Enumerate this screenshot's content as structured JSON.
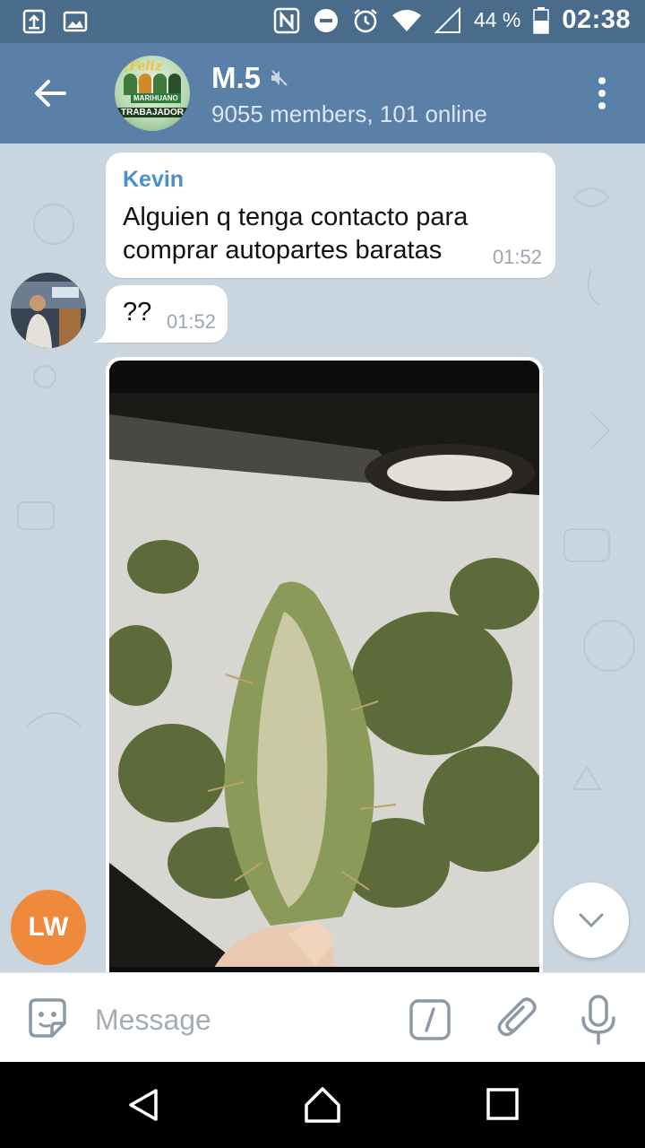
{
  "status_bar": {
    "icons": [
      "upload-icon",
      "image-icon",
      "nfc-icon",
      "do-not-disturb-icon",
      "alarm-icon",
      "wifi-icon",
      "signal-icon",
      "battery-icon"
    ],
    "battery_percent": "44 %",
    "time": "02:38"
  },
  "header": {
    "title": "M.5",
    "subtitle": "9055 members, 101 online",
    "avatar_text": {
      "line1": "¡Feliz día!",
      "line2": "MARIHUANO",
      "line3": "TRABAJADOR"
    },
    "muted": true
  },
  "messages": [
    {
      "sender": "Kevin",
      "text": "Alguien q tenga contacto para comprar autopartes baratas",
      "time": "01:52"
    },
    {
      "text": "??",
      "time": "01:52"
    }
  ],
  "photo_message": {
    "description_icon": "photo-of-plant"
  },
  "lw_avatar": {
    "initials": "LW",
    "color": "#ef8a3d"
  },
  "input": {
    "placeholder": "Message"
  },
  "colors": {
    "status_bar": "#4a6c8b",
    "app_bar": "#5a80a8",
    "chat_bg": "#c9d5df",
    "sender_name": "#4d8fc7"
  }
}
